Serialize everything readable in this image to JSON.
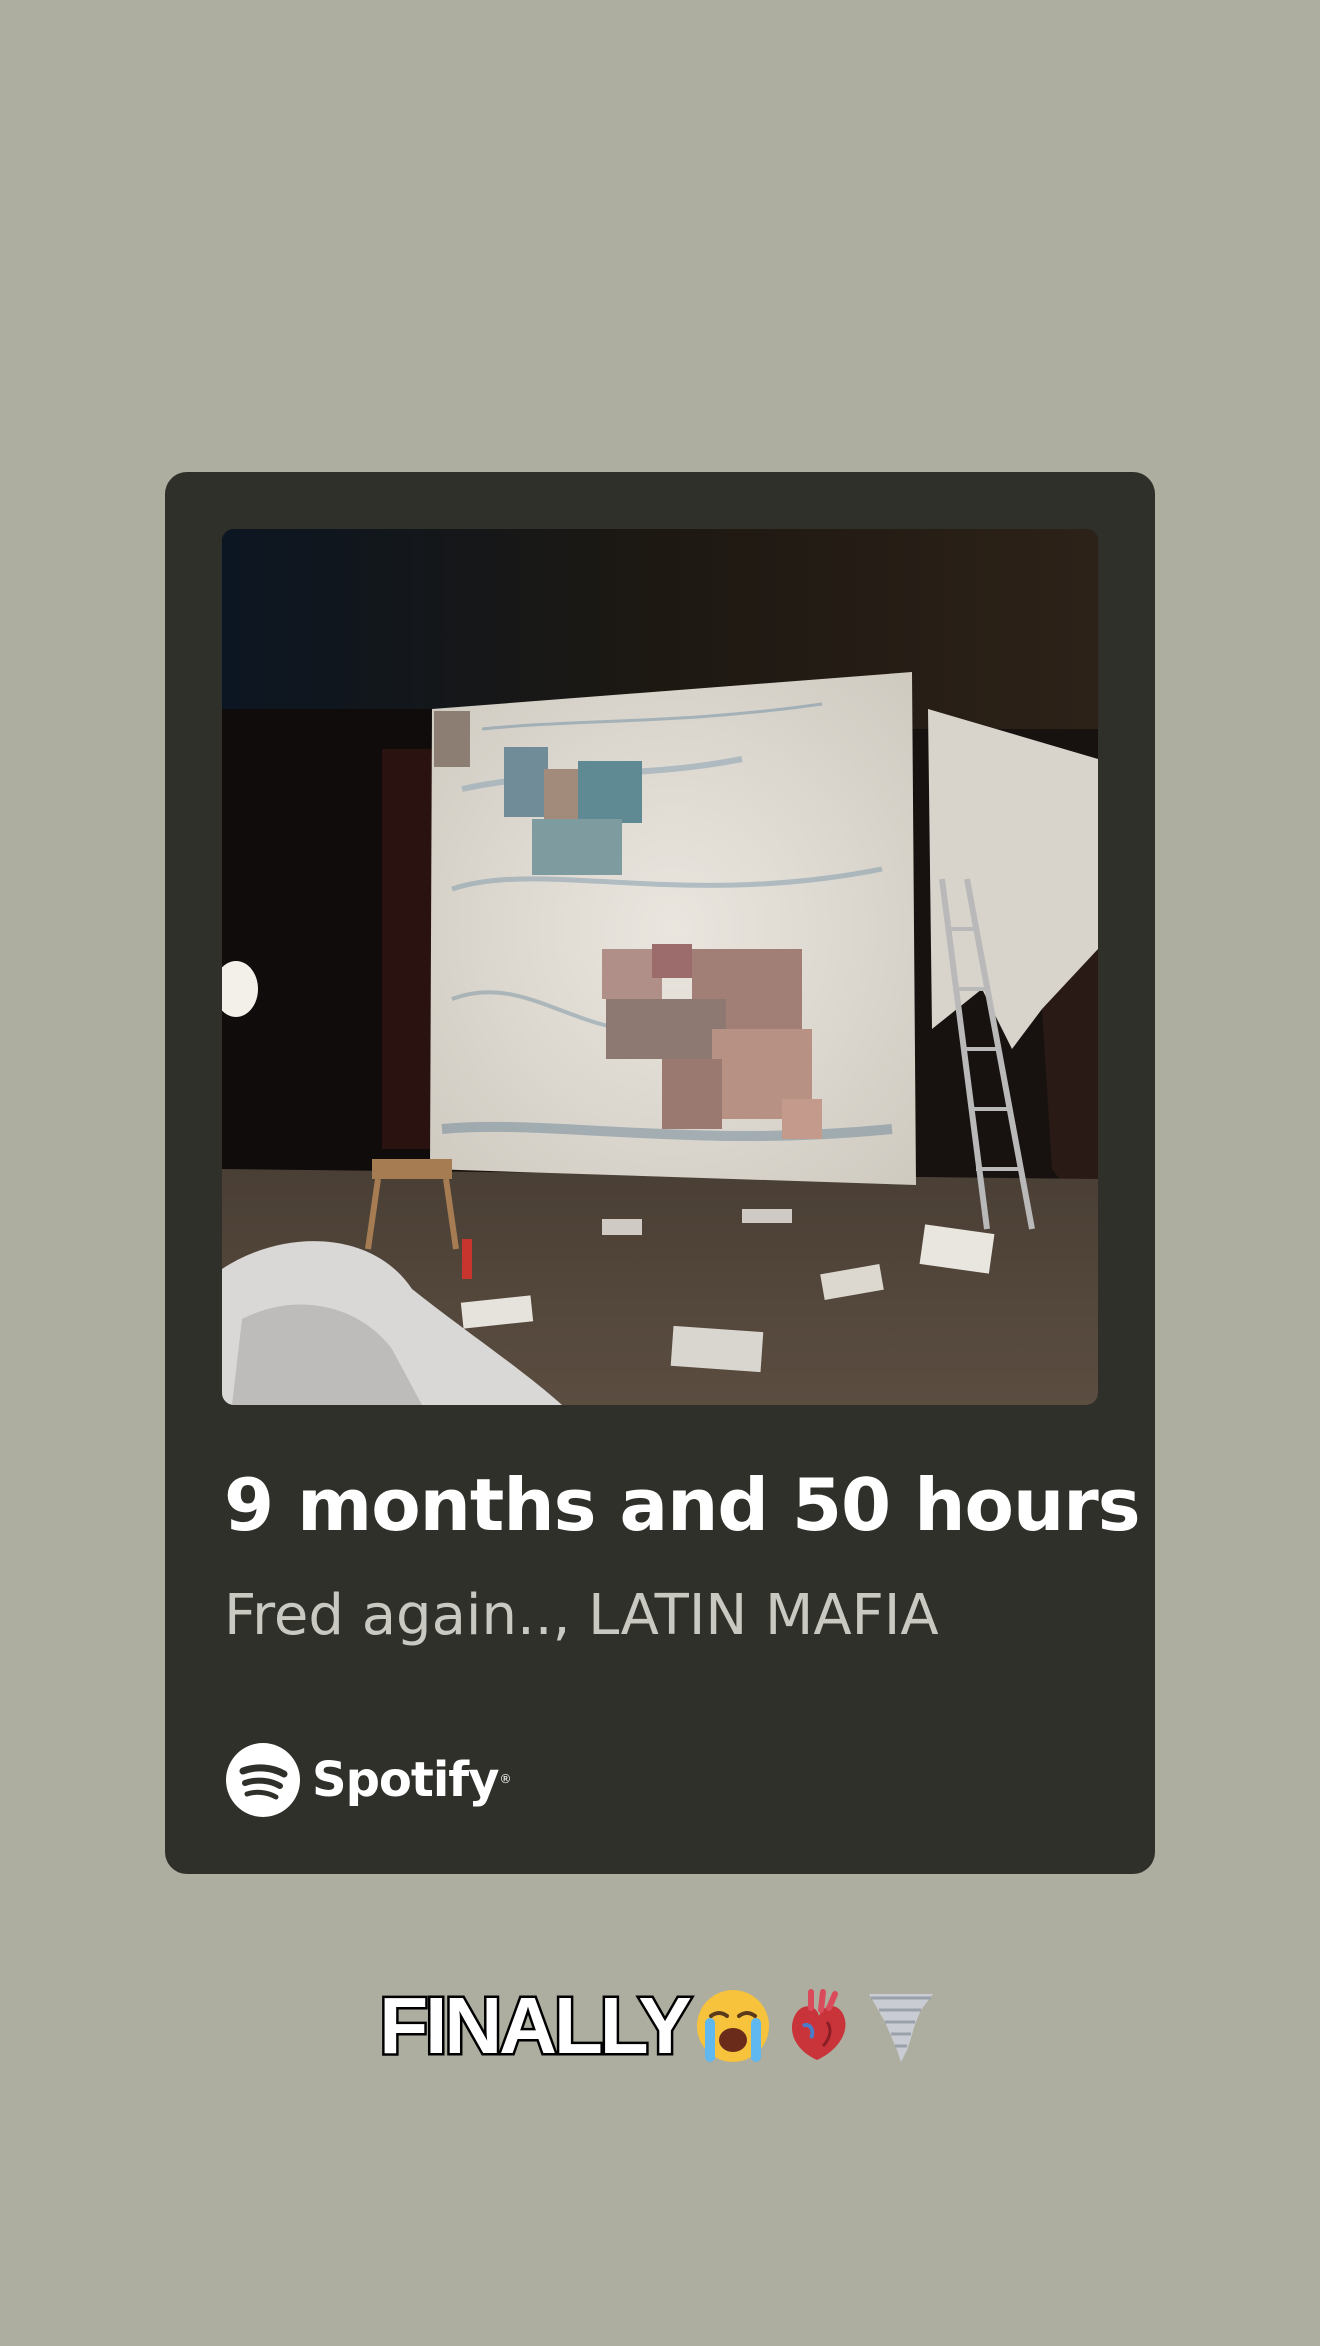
{
  "track": {
    "title": "9 months and 50 hours",
    "artists": "Fred again.., LATIN MAFIA"
  },
  "brand": {
    "name": "Spotify",
    "registered_mark": "®",
    "icon": "spotify-logo-icon"
  },
  "caption": {
    "text": "FINALLY",
    "emojis": [
      "loudly-crying-face-icon",
      "anatomical-heart-icon",
      "tornado-icon"
    ]
  },
  "colors": {
    "background": "#adae9f",
    "card": "#30302b",
    "title": "#ffffff",
    "artists": "#c9c9c2"
  }
}
